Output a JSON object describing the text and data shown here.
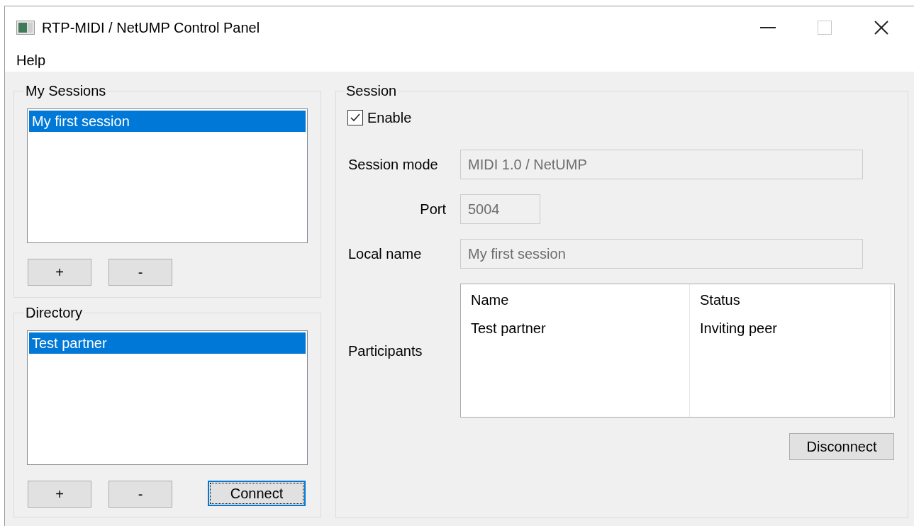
{
  "window": {
    "title": "RTP-MIDI / NetUMP Control Panel"
  },
  "menu": [
    {
      "label": "Help"
    }
  ],
  "my_sessions": {
    "title": "My Sessions",
    "items": [
      {
        "label": "My first session",
        "selected": true
      }
    ],
    "buttons": [
      {
        "label": "+",
        "focused": false
      },
      {
        "label": "-",
        "focused": false
      }
    ]
  },
  "directory": {
    "title": "Directory",
    "items": [
      {
        "label": "Test partner",
        "selected": true
      }
    ],
    "buttons": [
      {
        "label": "+",
        "focused": false
      },
      {
        "label": "-",
        "focused": false
      },
      {
        "label": "Connect",
        "focused": true
      }
    ]
  },
  "session": {
    "title": "Session",
    "enable": {
      "label": "Enable",
      "checked": true
    },
    "fields": [
      {
        "label": "Session mode",
        "value": "MIDI 1.0 / NetUMP",
        "disabled": true,
        "kind": "wide"
      },
      {
        "label": "Port",
        "value": "5004",
        "disabled": true,
        "kind": "narrow"
      },
      {
        "label": "Local name",
        "value": "My first session",
        "disabled": true,
        "kind": "wide"
      }
    ],
    "participants": {
      "label": "Participants",
      "columns": [
        "Name",
        "Status"
      ],
      "rows": [
        [
          "Test partner",
          "Inviting peer"
        ]
      ]
    },
    "buttons": [
      {
        "label": "Disconnect",
        "focused": false
      }
    ]
  }
}
